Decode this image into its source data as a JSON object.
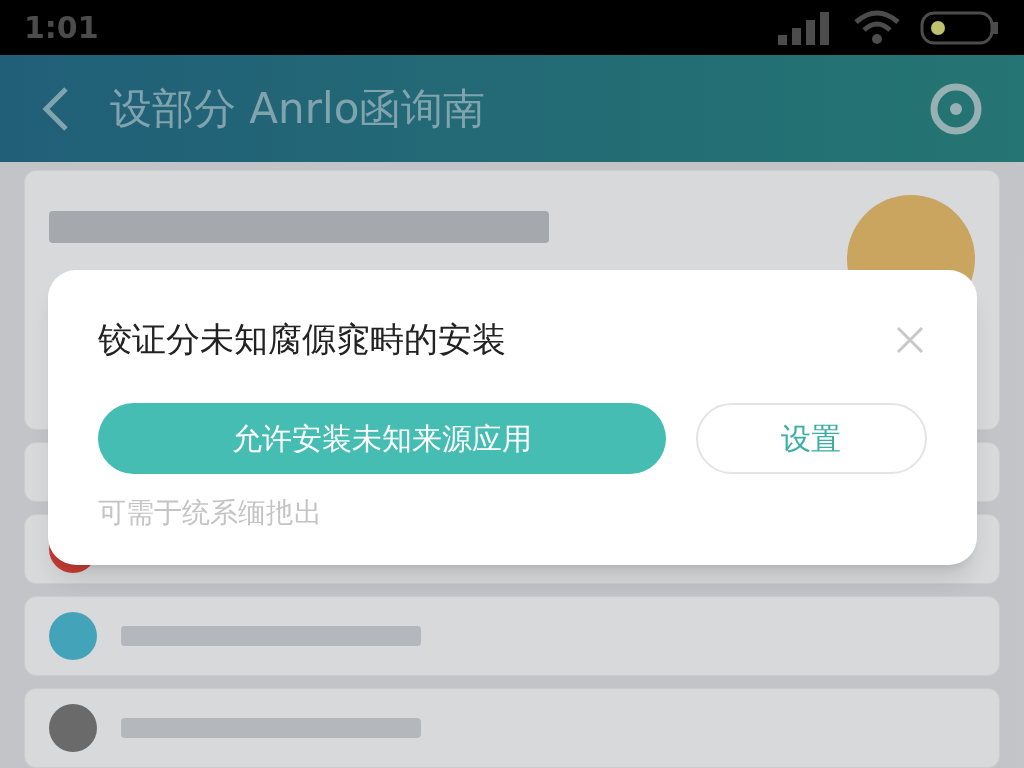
{
  "status_bar": {
    "time": "1:01"
  },
  "header": {
    "title": "设部分 Anrlo函询南"
  },
  "dialog": {
    "title": "铰证分未知腐傆窕畤的安装",
    "primary_button": "允许安装未知来源应用",
    "secondary_button": "设置",
    "footer": "可需于统系缅扡出"
  }
}
